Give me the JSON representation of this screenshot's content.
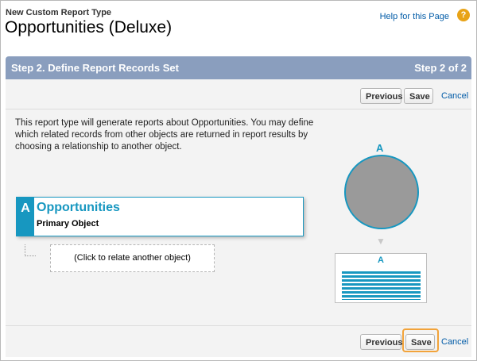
{
  "header": {
    "subtitle": "New Custom Report Type",
    "title": "Opportunities (Deluxe)",
    "help_link": "Help for this Page",
    "help_icon": "?"
  },
  "step": {
    "title": "Step 2. Define Report Records Set",
    "count": "Step 2 of 2"
  },
  "toolbar_top": {
    "previous": "Previous",
    "save": "Save",
    "cancel": "Cancel"
  },
  "description": "This report type will generate reports about Opportunities. You may define which related records from other objects are returned in report results by choosing a relationship to another object.",
  "primary_object": {
    "letter": "A",
    "name": "Opportunities",
    "label": "Primary Object"
  },
  "relate_placeholder": "(Click to relate another object)",
  "diagram": {
    "letter_top": "A",
    "letter_table": "A",
    "arrow": "down-arrow-icon"
  },
  "toolbar_bottom": {
    "previous": "Previous",
    "save": "Save",
    "cancel": "Cancel"
  },
  "colors": {
    "step_bar": "#8a9ebe",
    "accent": "#1797c0",
    "link": "#015ba7",
    "highlight": "#f2a33a"
  }
}
